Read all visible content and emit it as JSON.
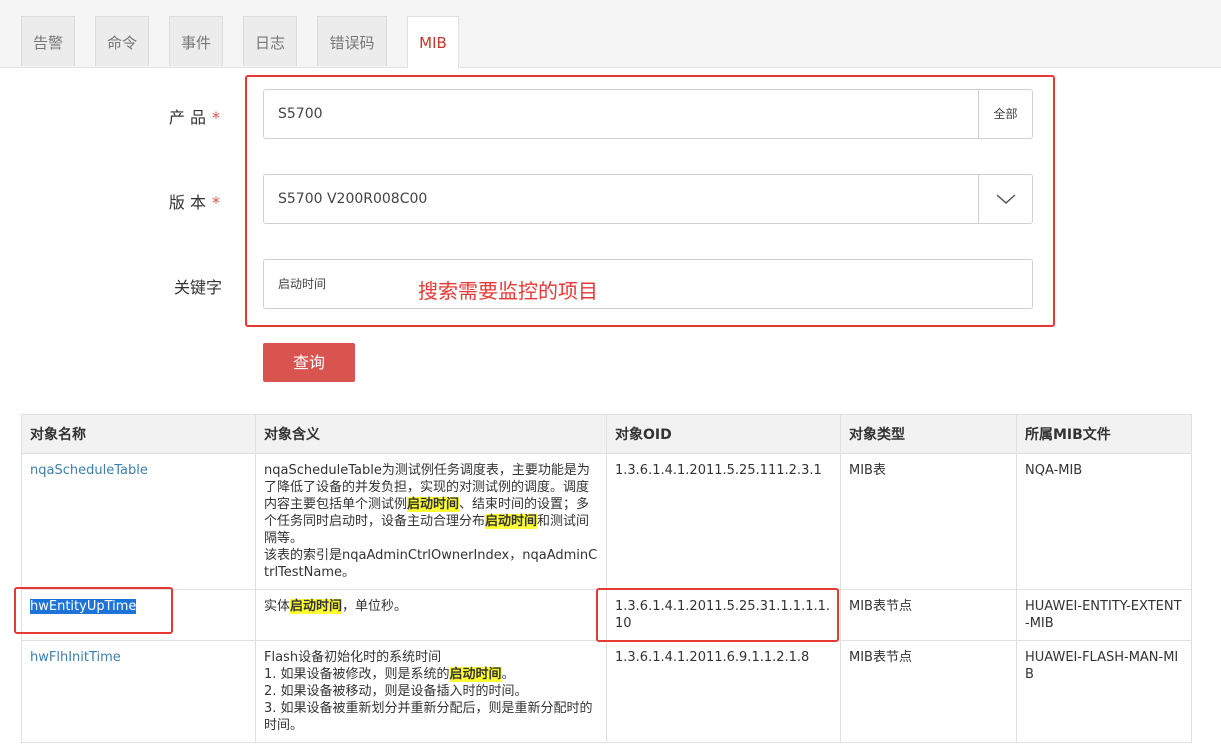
{
  "tabs": [
    "告警",
    "命令",
    "事件",
    "日志",
    "错误码",
    "MIB"
  ],
  "form": {
    "product_label": "产 品",
    "product_value": "S5700",
    "product_addon": "全部",
    "version_label": "版 本",
    "version_value": "S5700 V200R008C00",
    "keyword_label": "关键字",
    "keyword_value": "启动时间",
    "required_mark": "*",
    "annotation": "搜索需要监控的项目",
    "query_button": "查询"
  },
  "table": {
    "headers": [
      "对象名称",
      "对象含义",
      "对象OID",
      "对象类型",
      "所属MIB文件"
    ],
    "rows": [
      {
        "name": "nqaScheduleTable",
        "desc_a": "nqaScheduleTable为测试例任务调度表，主要功能是为了降低了设备的并发负担，实现的对测试例的调度。调度内容主要包括单个测试例",
        "desc_hl1": "启动时间",
        "desc_b": "、结束时间的设置；多个任务同时启动时，设备主动合理分布",
        "desc_hl2": "启动时间",
        "desc_c": "和测试间隔等。",
        "desc_d": "该表的索引是nqaAdminCtrlOwnerIndex，nqaAdminCtrlTestName。",
        "oid": "1.3.6.1.4.1.2011.5.25.111.2.3.1",
        "type": "MIB表",
        "file": "NQA-MIB"
      },
      {
        "name": "hwEntityUpTime",
        "desc_a": "实体",
        "desc_hl1": "启动时间",
        "desc_b": "，单位秒。",
        "oid": "1.3.6.1.4.1.2011.5.25.31.1.1.1.1.10",
        "type": "MIB表节点",
        "file": "HUAWEI-ENTITY-EXTENT-MIB"
      },
      {
        "name": "hwFlhInitTime",
        "desc_a": "Flash设备初始化时的系统时间",
        "desc_b": "1. 如果设备被修改，则是系统的",
        "desc_hl1": "启动时间",
        "desc_c": "。",
        "desc_d": "2. 如果设备被移动，则是设备插入时的时间。",
        "desc_e": "3. 如果设备被重新划分并重新分配后，则是重新分配时的时间。",
        "oid": "1.3.6.1.4.1.2011.6.9.1.1.2.1.8",
        "type": "MIB表节点",
        "file": "HUAWEI-FLASH-MAN-MIB"
      }
    ]
  },
  "colors": {
    "accent": "#d9534f",
    "annotation": "#e53935",
    "link": "#3a7fb0",
    "highlight": "#ffff33"
  }
}
